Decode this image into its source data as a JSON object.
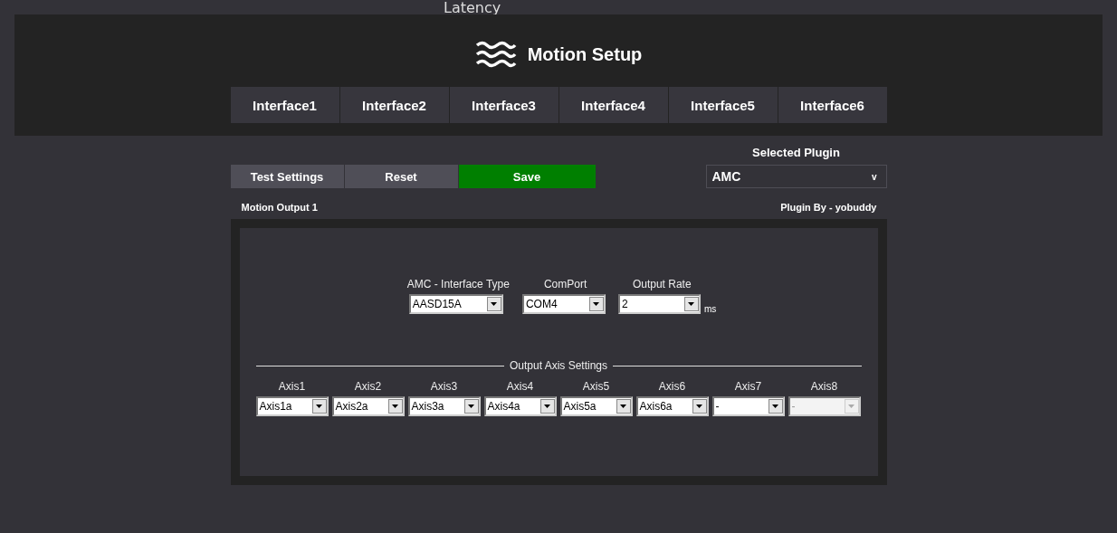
{
  "top_strip": {
    "text": "Latency"
  },
  "header": {
    "title": "Motion Setup"
  },
  "tabs": [
    {
      "label": "Interface1",
      "selected": false
    },
    {
      "label": "Interface2",
      "selected": false
    },
    {
      "label": "Interface3",
      "selected": false
    },
    {
      "label": "Interface4",
      "selected": false
    },
    {
      "label": "Interface5",
      "selected": false
    },
    {
      "label": "Interface6",
      "selected": false
    }
  ],
  "toolbar": {
    "buttons": [
      {
        "label": "Test Settings",
        "kind": "normal"
      },
      {
        "label": "Reset",
        "kind": "normal"
      },
      {
        "label": "Save",
        "kind": "primary"
      }
    ]
  },
  "plugin": {
    "label": "Selected Plugin",
    "value": "AMC",
    "caret": "v"
  },
  "section": {
    "title": "Motion Output 1",
    "author": "Plugin By - yobuddy"
  },
  "settings": [
    {
      "label": "AMC - Interface Type",
      "value": "AASD15A"
    },
    {
      "label": "ComPort",
      "value": "COM4"
    },
    {
      "label": "Output Rate",
      "value": "2",
      "unit": "ms"
    }
  ],
  "axis_settings": {
    "title": "Output Axis Settings",
    "axes": [
      {
        "label": "Axis1",
        "value": "Axis1a",
        "disabled": false
      },
      {
        "label": "Axis2",
        "value": "Axis2a",
        "disabled": false
      },
      {
        "label": "Axis3",
        "value": "Axis3a",
        "disabled": false
      },
      {
        "label": "Axis4",
        "value": "Axis4a",
        "disabled": false
      },
      {
        "label": "Axis5",
        "value": "Axis5a",
        "disabled": false
      },
      {
        "label": "Axis6",
        "value": "Axis6a",
        "disabled": false
      },
      {
        "label": "Axis7",
        "value": "-",
        "disabled": false
      },
      {
        "label": "Axis8",
        "value": "-",
        "disabled": true
      }
    ]
  }
}
